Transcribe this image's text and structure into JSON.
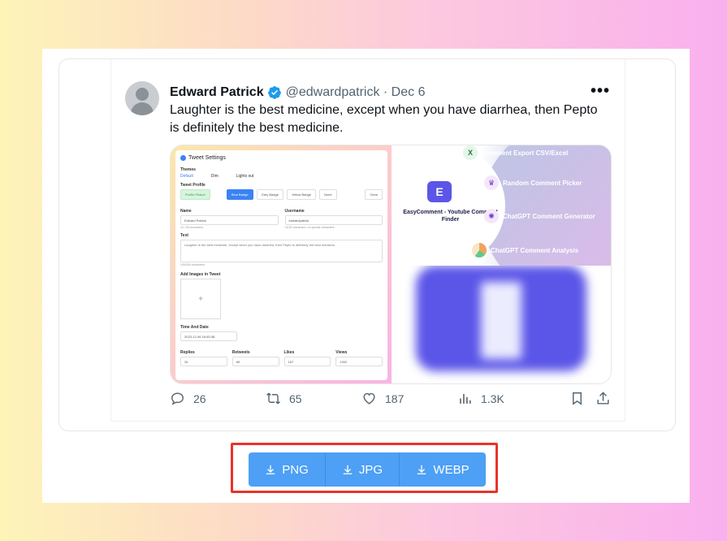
{
  "tweet": {
    "name": "Edward Patrick",
    "handle": "@edwardpatrick · Dec 6",
    "text": "Laughter is the best medicine, except when you have diarrhea, then Pepto is definitely the best medicine.",
    "replies": "26",
    "retweets": "65",
    "likes": "187",
    "views": "1.3K",
    "more_icon": "more-icon",
    "verified_color": "#1d9bf0"
  },
  "settings_screenshot": {
    "title": "Tweet Settings",
    "themes_label": "Themes",
    "themes": [
      "Default",
      "Dim",
      "Lights out"
    ],
    "profile_label": "Tweet Profile",
    "profile_picture": "Profile Picture",
    "badges": [
      "Blue Badge",
      "Grey Badge",
      "Yellow Badge",
      "None"
    ],
    "clear": "Clear",
    "name_label": "Name",
    "name_value": "Edward Patrick",
    "name_hint": "14 / 50 characters",
    "username_label": "Username",
    "username_value": "edwardpatrick",
    "username_hint": "13/15 characters, no special characters",
    "text_label": "Text",
    "text_value": "Laughter is the best medicine, except when you have diarrhea, then Pepto is definitely the best medicine.",
    "text_hint": "105/280 characters",
    "images_label": "Add Images in Tweet",
    "time_label": "Time And Date",
    "time_value": "2023-12-06 18:45:38",
    "replies_label": "Replies",
    "replies_value": "26",
    "retweets_label": "Retweets",
    "retweets_value": "65",
    "likes_label": "Likes",
    "likes_value": "187",
    "views_label": "Views",
    "views_value": "1302"
  },
  "promo": {
    "logo": "E",
    "title": "EasyComment - Youtube Comment Finder",
    "features": [
      "Comment  Export CSV/Excel",
      "Random Comment  Picker",
      "ChatGPT Comment Generator",
      "ChatGPT Comment Analysis"
    ]
  },
  "download": {
    "png": "PNG",
    "jpg": "JPG",
    "webp": "WEBP",
    "button_color": "#4da0f5",
    "highlight_color": "#e8332a"
  }
}
